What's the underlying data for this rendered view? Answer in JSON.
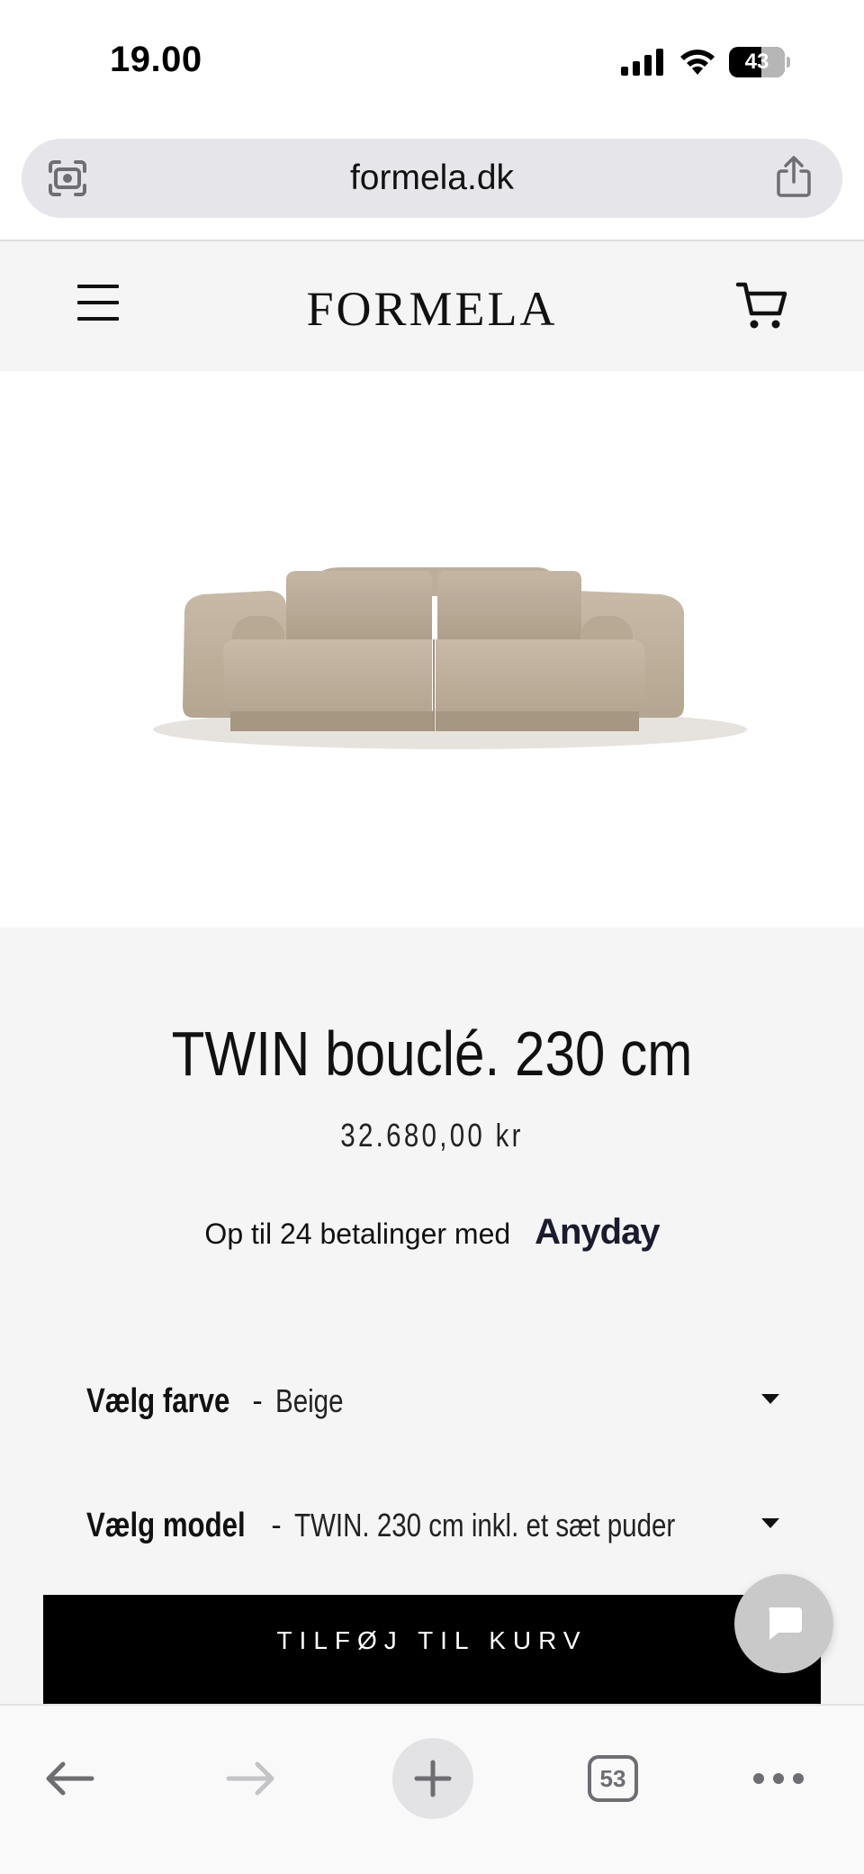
{
  "status_bar": {
    "time": "19.00",
    "battery": "43"
  },
  "browser": {
    "url": "formela.dk",
    "tab_count": "53"
  },
  "site": {
    "logo": "FORMELA"
  },
  "product": {
    "title": "TWIN bouclé. 230 cm",
    "price": "32.680,00 kr",
    "installment_text": "Op til 24 betalinger med",
    "installment_brand": "Anyday",
    "color_label": "Vælg farve",
    "color_value": "Beige",
    "model_label": "Vælg model",
    "model_value": "TWIN. 230 cm inkl. et sæt puder",
    "add_to_cart_label": "TILFØJ TIL KURV",
    "separator": "-",
    "sofa_color": "#c3b5a2"
  }
}
